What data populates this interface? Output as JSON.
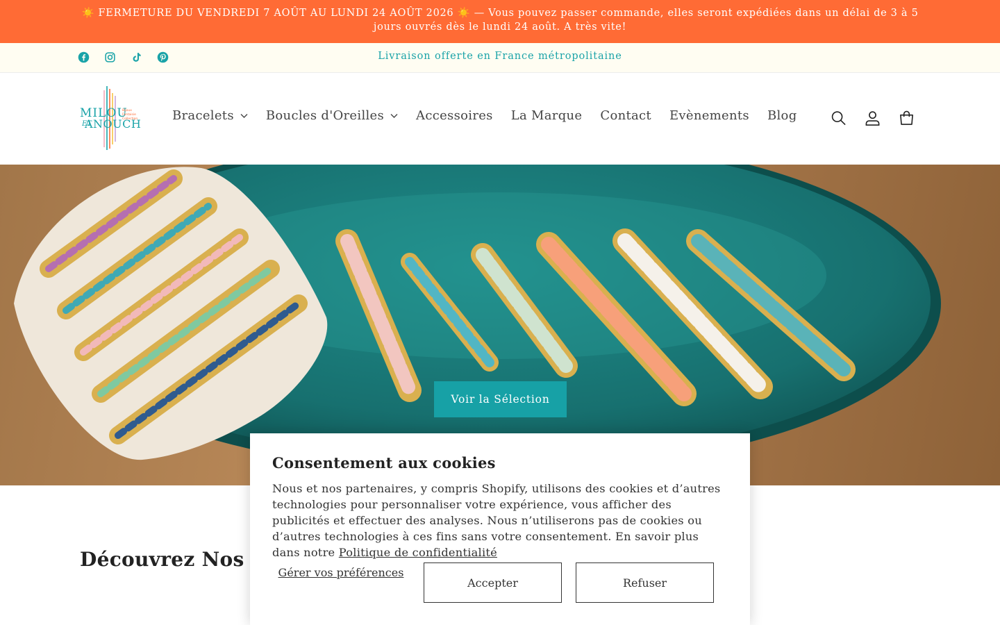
{
  "announcement": {
    "text": "☀️ FERMETURE DU VENDREDI 7 AOÛT AU LUNDI 24 AOÛT 2026 ☀️ — Vous pouvez passer commande, elles seront expédiées dans un délai de 3 à 5 jours ouvrés dès le lundi 24 août. A très vite!"
  },
  "colors": {
    "announcement_bg": "#ff6b35",
    "accent_teal": "#17a1a6",
    "infobar_bg": "#fffdf2"
  },
  "socials": [
    {
      "icon": "facebook-icon"
    },
    {
      "icon": "instagram-icon"
    },
    {
      "icon": "tiktok-icon"
    },
    {
      "icon": "pinterest-icon"
    }
  ],
  "shipping_notice": "Livraison offerte en France métropolitaine",
  "logo": {
    "line1": "MILOU",
    "line2": "ET",
    "line3": "ANOUCH",
    "tagline": [
      "Bijoux",
      "Fantaisie",
      "Collection"
    ]
  },
  "nav": {
    "items": [
      {
        "label": "Bracelets",
        "has_dropdown": true
      },
      {
        "label": "Boucles d'Oreilles",
        "has_dropdown": true
      },
      {
        "label": "Accessoires",
        "has_dropdown": false
      },
      {
        "label": "La Marque",
        "has_dropdown": false
      },
      {
        "label": "Contact",
        "has_dropdown": false
      },
      {
        "label": "Evènements",
        "has_dropdown": false
      },
      {
        "label": "Blog",
        "has_dropdown": false
      }
    ]
  },
  "header_icons": [
    "search-icon",
    "account-icon",
    "cart-icon"
  ],
  "hero": {
    "cta_label": "Voir la Sélection"
  },
  "section": {
    "title": "Découvrez Nos Nouv"
  },
  "cookie_banner": {
    "title": "Consentement aux cookies",
    "body": "Nous et nos partenaires, y compris Shopify, utilisons des cookies et d’autres technologies pour personnaliser votre expérience, vous afficher des publicités et effectuer des analyses. Nous n’utiliserons pas de cookies ou d’autres technologies à ces fins sans votre consentement. En savoir plus dans notre",
    "link_label": "Politique de confidentialité",
    "manage_label": "Gérer vos préférences",
    "accept_label": "Accepter",
    "refuse_label": "Refuser"
  }
}
